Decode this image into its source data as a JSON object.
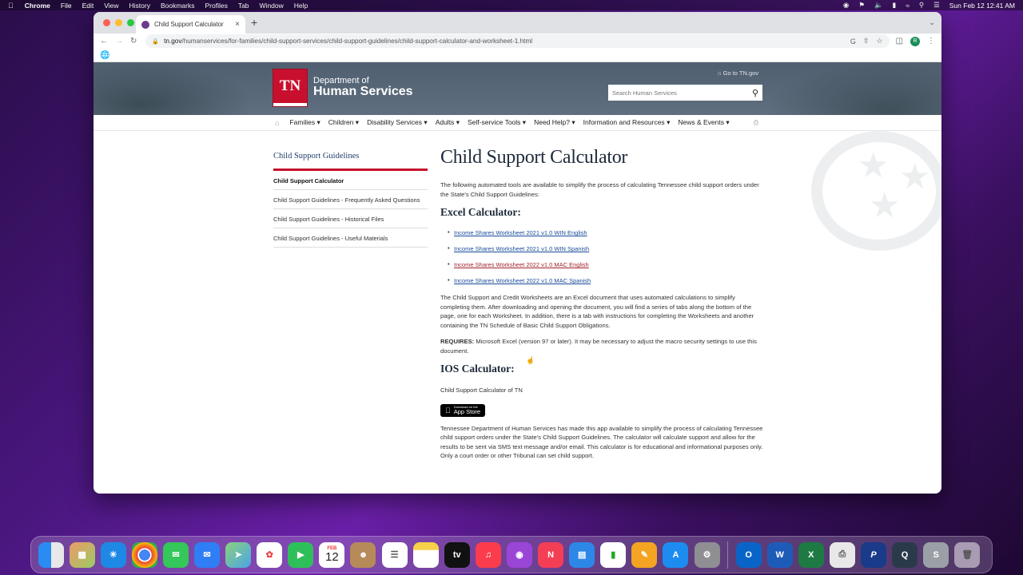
{
  "menubar": {
    "app": "Chrome",
    "items": [
      "File",
      "Edit",
      "View",
      "History",
      "Bookmarks",
      "Profiles",
      "Tab",
      "Window",
      "Help"
    ],
    "datetime": "Sun Feb 12  12:41 AM"
  },
  "browser": {
    "tab_title": "Child Support Calculator",
    "url_domain": "tn.gov",
    "url_path": "/humanservices/for-families/child-support-services/child-support-guidelines/child-support-calculator-and-worksheet-1.html",
    "profile_initial": "R"
  },
  "header": {
    "logo_text": "TN",
    "dept_line1": "Department of",
    "dept_line2": "Human Services",
    "goto_link": "Go to TN.gov",
    "search_placeholder": "Search Human Services"
  },
  "mainnav": [
    "Families",
    "Children",
    "Disability Services",
    "Adults",
    "Self-service Tools",
    "Need Help?",
    "Information and Resources",
    "News & Events"
  ],
  "sidebar": {
    "title": "Child Support Guidelines",
    "items": [
      {
        "label": "Child Support Calculator"
      },
      {
        "label": "Child Support Guidelines - Frequently Asked Questions"
      },
      {
        "label": "Child Support Guidelines - Historical Files"
      },
      {
        "label": "Child Support Guidelines - Useful Materials"
      }
    ]
  },
  "main": {
    "title": "Child Support Calculator",
    "intro": "The following automated tools are available to simplify the process of calculating Tennessee child support orders under the State's Child Support Guidelines:",
    "excel_heading": "Excel Calculator:",
    "excel_links": [
      "Income Shares Worksheet 2021 v1.0 WIN English",
      "Income Shares Worksheet 2021 v1.0 WIN Spanish",
      "Income Shares Worksheet 2022 v1.0 MAC English",
      "Income Shares Worksheet 2022 v1.0 MAC Spanish"
    ],
    "excel_desc": "The Child Support and Credit Worksheets are an Excel document that uses automated calculations to simplify completing them. After downloading and opening the document, you will find a series of tabs along the bottom of the page, one for each Worksheet. In addition, there is a tab with instructions for completing the Worksheets and another containing the TN Schedule of Basic Child Support Obligations.",
    "requires_label": "REQUIRES:",
    "requires_text": " Microsoft Excel (version 97 or later). It may be necessary to adjust the macro security settings to use this document.",
    "ios_heading": "IOS Calculator:",
    "ios_app_name": "Child Support Calculator of TN",
    "appstore_small": "Download on the",
    "appstore_big": "App Store",
    "ios_desc": "Tennessee Department of Human Services has made this app available to simplify the process of calculating Tennessee child support orders under the State's Child Support Guidelines. The calculator will calculate support and allow for the results to be sent via SMS text message and/or email. This calculator is for educational and informational purposes only. Only a court order or other Tribunal can set child support."
  },
  "dock": {
    "calendar_month": "FEB",
    "calendar_day": "12",
    "apps": [
      "Finder",
      "Launchpad",
      "Safari",
      "Chrome",
      "Messages",
      "Mail",
      "Maps",
      "Photos",
      "FaceTime",
      "Calendar",
      "Contacts",
      "Reminders",
      "Notes",
      "TV",
      "Music",
      "Podcasts",
      "News",
      "Keynote",
      "Numbers",
      "Pages",
      "App Store",
      "System Preferences",
      "Outlook",
      "Word",
      "Excel",
      "Printer",
      "Pages Alt",
      "QuickTime",
      "Sketch",
      "Trash"
    ]
  },
  "colors": {
    "brand_red": "#c8102e",
    "header_bg": "#56667a",
    "link": "#1a4b9a",
    "visited_link": "#a0252f"
  }
}
